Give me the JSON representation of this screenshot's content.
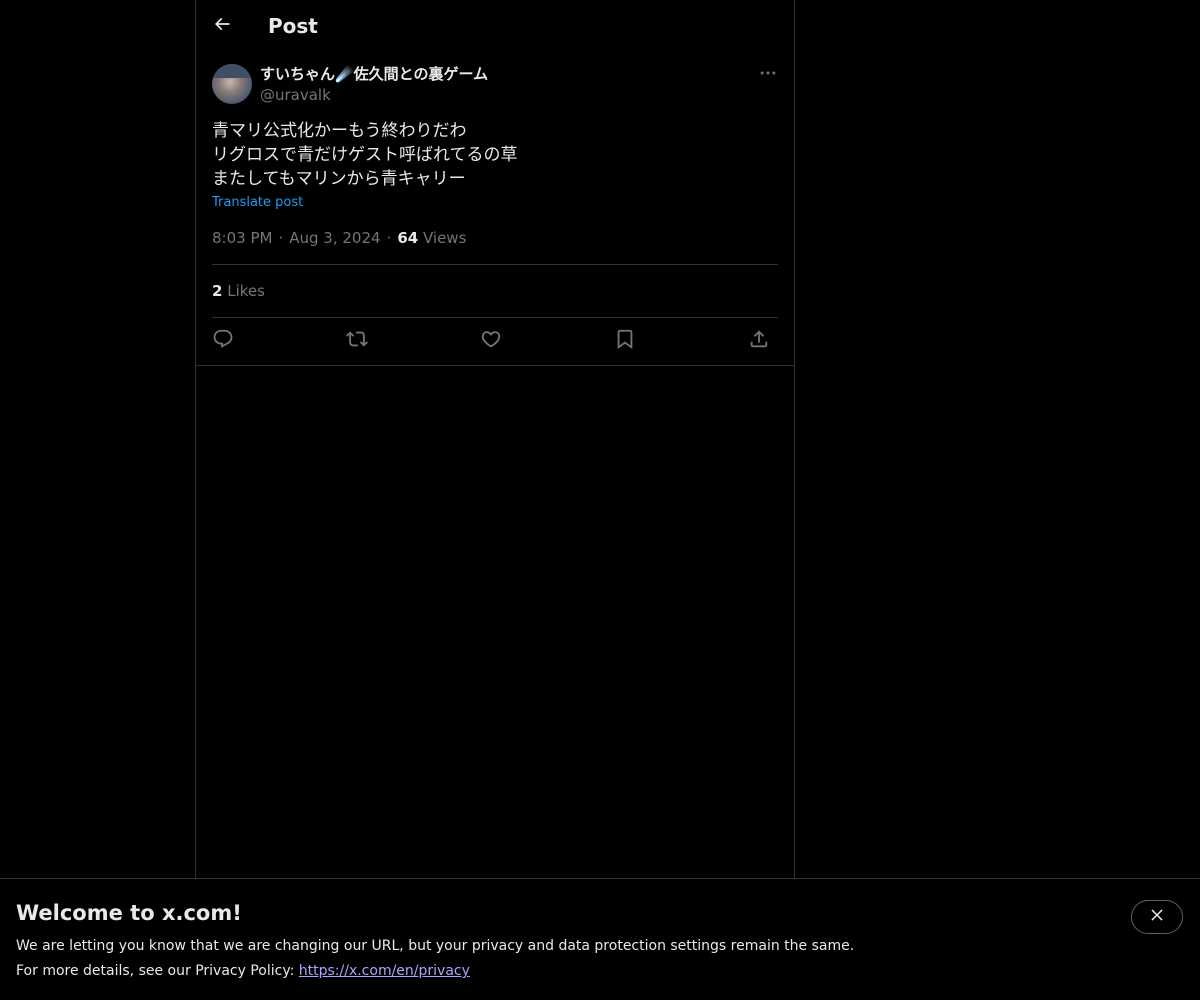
{
  "header": {
    "title": "Post"
  },
  "post": {
    "author": {
      "display_name": "すいちゃん☄️佐久間との裏ゲーム",
      "handle": "@uravalk"
    },
    "lines": [
      "青マリ公式化かーもう終わりだわ",
      "リグロスで青だけゲスト呼ばれてるの草",
      "またしてもマリンから青キャリー"
    ],
    "translate_label": "Translate post",
    "time": "8:03 PM",
    "date": "Aug 3, 2024",
    "views_count": "64",
    "views_label": "Views",
    "likes_count": "2",
    "likes_label": "Likes"
  },
  "actions": {
    "reply_icon": "reply-icon",
    "repost_icon": "repost-icon",
    "like_icon": "heart-icon",
    "bookmark_icon": "bookmark-icon",
    "share_icon": "share-icon"
  },
  "banner": {
    "title": "Welcome to x.com!",
    "line1": "We are letting you know that we are changing our URL, but your privacy and data protection settings remain the same.",
    "line2_prefix": "For more details, see our Privacy Policy: ",
    "link_text": "https://x.com/en/privacy"
  },
  "colors": {
    "background": "#000000",
    "text_primary": "#e7e9ea",
    "text_secondary": "#71767b",
    "link": "#1d9bf0",
    "border": "#2f3336"
  }
}
